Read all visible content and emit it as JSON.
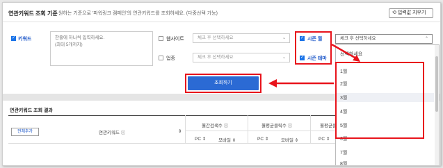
{
  "header": {
    "title": "연관키워드 조회 기준",
    "description": "원하는 기준으로 '파워링크 캠페인'의 연관키워드를 조회하세요. (다중선택 가능)",
    "reset_label": "입력값 지우기"
  },
  "criteria": {
    "keyword_label": "키워드",
    "keyword_placeholder": "한줄에 하나씩 입력하세요.",
    "keyword_placeholder_2": "(최대 5개까지)",
    "website_label": "웹사이트",
    "industry_label": "업종",
    "season_month_label": "시즌 월",
    "season_theme_label": "시즌 테마",
    "select_placeholder": "체크 후 선택하세요",
    "search_label": "조회하기"
  },
  "dropdown": {
    "selected": "체크 후 선택하세요",
    "first_option": "선택하세요",
    "months": [
      "1월",
      "2월",
      "3월",
      "4월",
      "5월",
      "6월",
      "7월",
      "8월"
    ],
    "highlighted_index": 2
  },
  "results": {
    "title": "연관키워드 조회 결과",
    "add_all_label": "전체추가",
    "col_keyword": "연관키워드",
    "col_monthly_search": "월간검색수",
    "col_monthly_clicks": "월평균클릭수",
    "col_monthly_ctr": "월평균클",
    "sub_pc": "PC",
    "sub_mobile": "모바일"
  },
  "colors": {
    "accent": "#2b6ad4",
    "highlight_box": "#e8131b"
  }
}
